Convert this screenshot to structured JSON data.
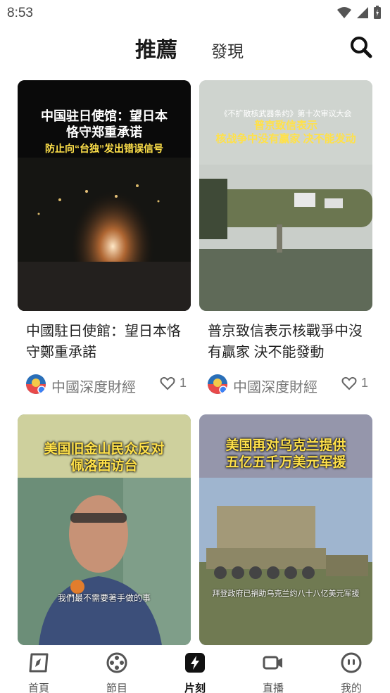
{
  "status_bar": {
    "time": "8:53"
  },
  "tabs": {
    "recommend": "推薦",
    "discover": "發現"
  },
  "cards": [
    {
      "thumb_line1": "中国驻日使馆：望日本",
      "thumb_line2": "恪守郑重承诺",
      "thumb_line3": "防止向“台独”发出错误信号",
      "title": "中國駐日使館：望日本恪守鄭重承諾",
      "author": "中國深度財經",
      "likes": "1"
    },
    {
      "thumb_line1": "《不扩散核武器条约》第十次审议大会",
      "thumb_line2": "普京致信表示",
      "thumb_line3": "核战争中没有赢家 决不能发动",
      "title": "普京致信表示核戰爭中沒有贏家 決不能發動",
      "author": "中國深度財經",
      "likes": "1"
    },
    {
      "thumb_line1": "美国旧金山民众反对",
      "thumb_line2": "佩洛西访台",
      "caption": "我們最不需要著手做的事"
    },
    {
      "thumb_line1": "美国再对乌克兰提供",
      "thumb_line2": "五亿五千万美元军援",
      "caption": "拜登政府已捐助乌克兰约八十八亿美元军援"
    }
  ],
  "nav": {
    "home": "首頁",
    "programs": "節目",
    "clips": "片刻",
    "live": "直播",
    "mine": "我的"
  },
  "colors": {
    "accent": "#111111",
    "muted": "#777777",
    "thumb_yellow": "#ffe14a"
  }
}
